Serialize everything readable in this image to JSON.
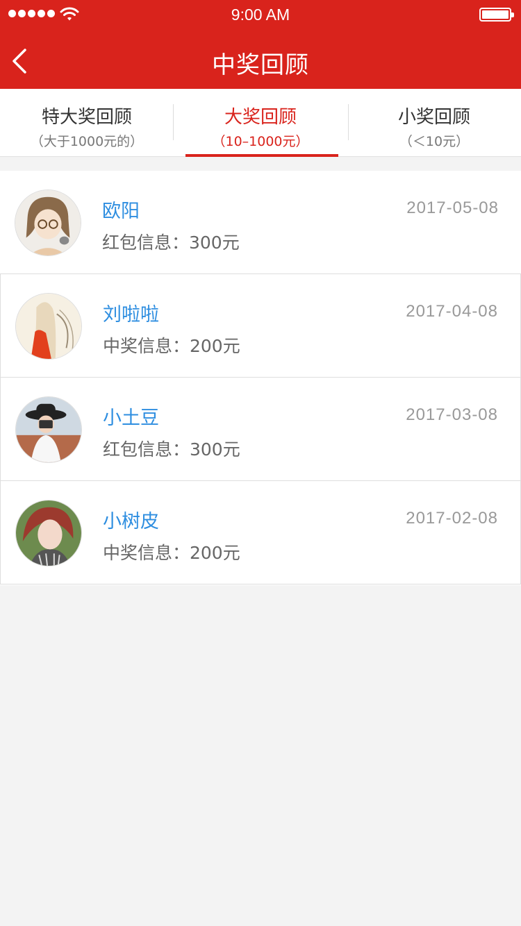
{
  "status_bar": {
    "time": "9:00 AM"
  },
  "nav": {
    "title": "中奖回顾"
  },
  "tabs": [
    {
      "label": "特大奖回顾",
      "sub": "（大于1000元的）"
    },
    {
      "label": "大奖回顾",
      "sub": "（10–1000元）"
    },
    {
      "label": "小奖回顾",
      "sub": "（＜10元）"
    }
  ],
  "active_tab": 1,
  "records": [
    {
      "name": "欧阳",
      "info": "红包信息：300元",
      "date": "2017-05-08"
    },
    {
      "name": "刘啦啦",
      "info": "中奖信息：200元",
      "date": "2017-04-08"
    },
    {
      "name": "小土豆",
      "info": "红包信息：300元",
      "date": "2017-03-08"
    },
    {
      "name": "小树皮",
      "info": "中奖信息：200元",
      "date": "2017-02-08"
    }
  ],
  "colors": {
    "brand": "#d9231c",
    "name_link": "#2e8ee0",
    "background": "#f3f3f3"
  },
  "icons": [
    "back-arrow-icon",
    "wifi-icon",
    "battery-icon",
    "signal-dots-icon"
  ]
}
